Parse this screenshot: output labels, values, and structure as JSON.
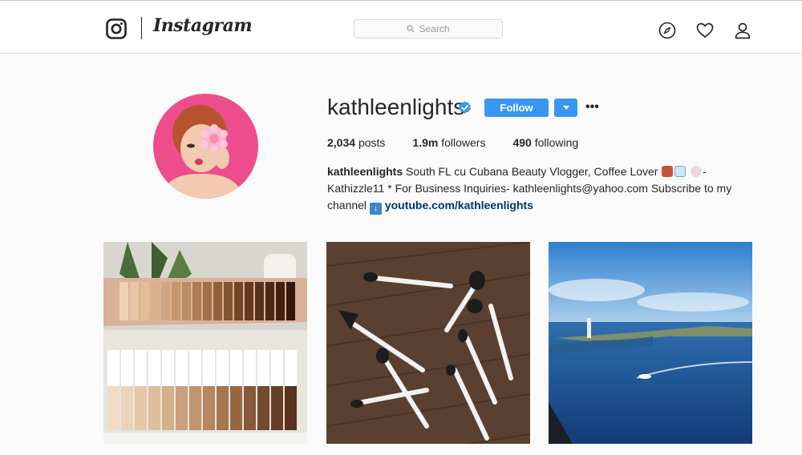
{
  "header": {
    "brand": "Instagram",
    "search_placeholder": "Search",
    "icons": [
      "instagram-camera-icon",
      "compass-icon",
      "heart-icon",
      "user-icon"
    ]
  },
  "profile": {
    "username": "kathleenlights",
    "verified": true,
    "follow_label": "Follow",
    "stats": {
      "posts_count": "2,034",
      "posts_label": "posts",
      "followers_count": "1.9m",
      "followers_label": "followers",
      "following_count": "490",
      "following_label": "following"
    },
    "bio": {
      "name": "kathleenlights",
      "line1": "South FL cu Cubana Beauty Vlogger, Coffee Lover",
      "line1_tail": "-",
      "line2": "Kathizzle11 * For Business Inquiries- kathleenlights@yahoo.com Subscribe to my",
      "line3": "channel",
      "link": "youtube.com/kathleenlights"
    }
  },
  "posts": [
    {
      "subject": "makeup-swatches-arm"
    },
    {
      "subject": "makeup-brushes-on-wood"
    },
    {
      "subject": "ocean-lighthouse-view"
    }
  ],
  "colors": {
    "accent": "#3897f0",
    "link": "#003569",
    "border": "#dbdbdb",
    "background": "#fafafa"
  }
}
